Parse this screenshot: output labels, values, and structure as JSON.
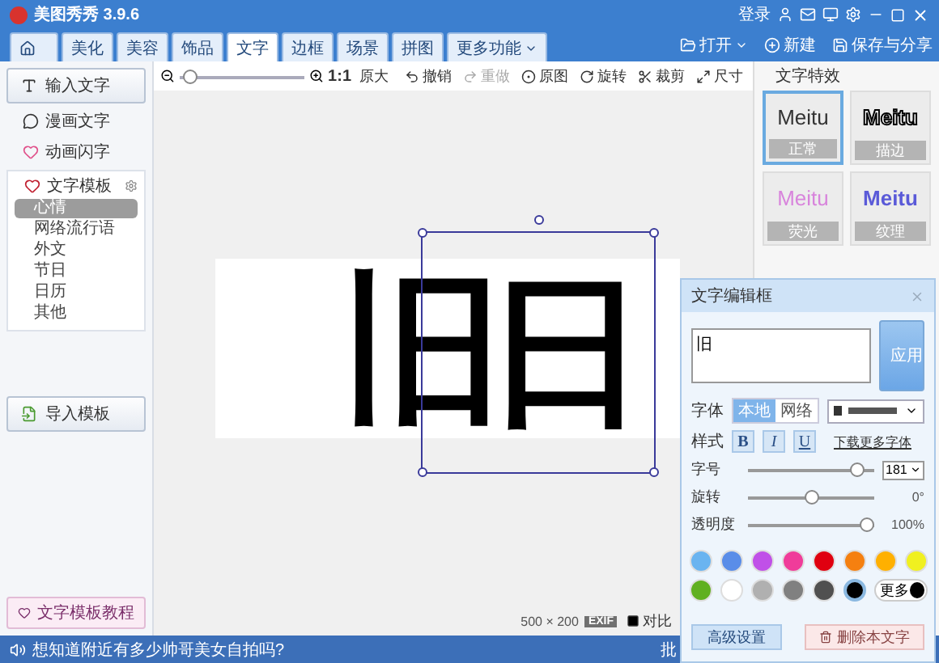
{
  "window": {
    "title": "美图秀秀 3.9.6",
    "login": "登录"
  },
  "tabs": [
    {
      "kind": "home",
      "selected": false
    },
    {
      "kind": "text",
      "label": "美化",
      "selected": false
    },
    {
      "kind": "text",
      "label": "美容",
      "selected": false
    },
    {
      "kind": "text",
      "label": "饰品",
      "selected": false
    },
    {
      "kind": "text",
      "label": "文字",
      "selected": true
    },
    {
      "kind": "text",
      "label": "边框",
      "selected": false
    },
    {
      "kind": "text",
      "label": "场景",
      "selected": false
    },
    {
      "kind": "text",
      "label": "拼图",
      "selected": false
    },
    {
      "kind": "menu",
      "label": "更多功能",
      "selected": false
    }
  ],
  "top_actions": [
    {
      "kind": "open",
      "label": "打开"
    },
    {
      "kind": "new",
      "label": "新建"
    },
    {
      "kind": "save",
      "label": "保存与分享"
    }
  ],
  "sidebar": {
    "input_button": "输入文字",
    "links": [
      {
        "kind": "comic",
        "label": "漫画文字"
      },
      {
        "kind": "flash",
        "label": "动画闪字"
      }
    ],
    "templates": {
      "title": "文字模板",
      "items": [
        {
          "label": "心情",
          "selected": true
        },
        {
          "label": "网络流行语",
          "selected": false
        },
        {
          "label": "外文",
          "selected": false
        },
        {
          "label": "节日",
          "selected": false
        },
        {
          "label": "日历",
          "selected": false
        },
        {
          "label": "其他",
          "selected": false
        }
      ]
    },
    "import_button": "导入模板",
    "tutorial_button": "文字模板教程"
  },
  "edit_toolbar": {
    "zoom": {
      "level": 0.03
    },
    "actual_size": "1:1",
    "original_size": "原大",
    "actions": [
      {
        "kind": "undo",
        "label": "撤销",
        "disabled": false
      },
      {
        "kind": "redo",
        "label": "重做",
        "disabled": true
      },
      {
        "kind": "original",
        "label": "原图",
        "disabled": false
      },
      {
        "kind": "rotate",
        "label": "旋转",
        "disabled": false
      },
      {
        "kind": "crop",
        "label": "裁剪",
        "disabled": false
      },
      {
        "kind": "resize",
        "label": "尺寸",
        "disabled": false
      }
    ]
  },
  "canvas": {
    "text": "旧",
    "selected_text": "日"
  },
  "info_bar": {
    "dimensions": "500 × 200",
    "exif": "EXIF",
    "compare": "对比"
  },
  "effects": {
    "title": "文字特效",
    "items": [
      {
        "kind": "normal",
        "sample": "Meitu",
        "label": "正常",
        "selected": true
      },
      {
        "kind": "outline",
        "sample": "Meitu",
        "label": "描边",
        "selected": false
      },
      {
        "kind": "glow",
        "sample": "Meitu",
        "label": "荧光",
        "selected": false
      },
      {
        "kind": "texture",
        "sample": "Meitu",
        "label": "纹理",
        "selected": false
      }
    ]
  },
  "text_editor": {
    "title": "文字编辑框",
    "text": "旧",
    "apply": "应用",
    "font_label": "字体",
    "font_sources": [
      {
        "label": "本地",
        "selected": true
      },
      {
        "label": "网络",
        "selected": false
      }
    ],
    "style_label": "样式",
    "styles": [
      {
        "kind": "bold",
        "label": "B"
      },
      {
        "kind": "italic",
        "label": "I"
      },
      {
        "kind": "underline",
        "label": "U"
      }
    ],
    "download_link": "下载更多字体",
    "sliders": [
      {
        "kind": "select",
        "label": "字号",
        "level": 0.92,
        "value": "181"
      },
      {
        "kind": "text",
        "label": "旋转",
        "level": 0.5,
        "value": "0°"
      },
      {
        "kind": "text",
        "label": "透明度",
        "level": 1,
        "value": "100%"
      }
    ],
    "colors": [
      {
        "color": "#6ab4f0",
        "selected": false
      },
      {
        "color": "#5a8de8",
        "selected": false
      },
      {
        "color": "#c050e8",
        "selected": false
      },
      {
        "color": "#f03c9a",
        "selected": false
      },
      {
        "color": "#e00010",
        "selected": false
      },
      {
        "color": "#f58010",
        "selected": false
      },
      {
        "color": "#ffb000",
        "selected": false
      },
      {
        "color": "#f0f020",
        "selected": false
      },
      {
        "color": "#60b020",
        "selected": false
      },
      {
        "color": "#ffffff",
        "selected": false
      },
      {
        "color": "#b0b0b0",
        "selected": false
      },
      {
        "color": "#808080",
        "selected": false
      },
      {
        "color": "#505050",
        "selected": false
      },
      {
        "color": "#000000",
        "selected": true
      }
    ],
    "more_colors": "更多",
    "advanced": "高级设置",
    "delete": "删除本文字"
  },
  "status_bar": {
    "message": "想知道附近有多少帅哥美女自拍吗?",
    "right": "批"
  }
}
